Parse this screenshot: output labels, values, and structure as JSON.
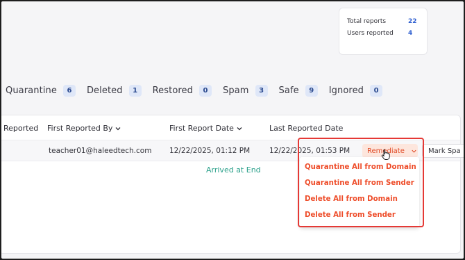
{
  "stats": {
    "items": [
      {
        "label": "Total reports",
        "value": "22"
      },
      {
        "label": "Users reported",
        "value": "4"
      }
    ]
  },
  "tabs": [
    {
      "label": "Quarantine",
      "count": "6"
    },
    {
      "label": "Deleted",
      "count": "1"
    },
    {
      "label": "Restored",
      "count": "0"
    },
    {
      "label": "Spam",
      "count": "3"
    },
    {
      "label": "Safe",
      "count": "9"
    },
    {
      "label": "Ignored",
      "count": "0"
    }
  ],
  "table": {
    "headers": {
      "reported": "Reported",
      "first_reported_by": "First Reported By",
      "first_report_date": "First Report Date",
      "last_reported_date": "Last Reported Date"
    },
    "row": {
      "first_reported_by": "teacher01@haleedtech.com",
      "first_report_date": "12/22/2025, 01:12 PM",
      "last_reported_date": "12/22/2025, 01:53 PM"
    },
    "footer_text": "Arrived at End"
  },
  "actions": {
    "remediate_label": "Remediate",
    "mark_spam_label": "Mark Spa"
  },
  "remediate_menu": [
    "Quarantine All from Domain",
    "Quarantine All from Sender",
    "Delete All from Domain",
    "Delete All from Sender"
  ],
  "colors": {
    "accent_link": "#2f5fd0",
    "badge_bg": "#dfe7f8",
    "remediate_text": "#e04a26",
    "highlight_border": "#e53935",
    "arrived_text": "#2aa08a"
  }
}
